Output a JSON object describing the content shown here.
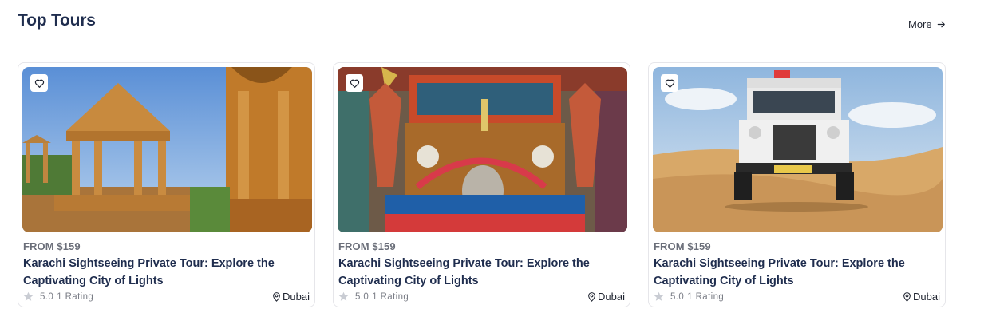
{
  "section": {
    "title": "Top Tours",
    "more_label": "More"
  },
  "cards": [
    {
      "image_label": "Sandstone cenotaph pavilions",
      "price": "FROM $159",
      "title": "Karachi Sightseeing Private Tour: Explore the Captivating City of Lights",
      "rating": "5.0",
      "rating_count": "1 Rating",
      "location": "Dubai"
    },
    {
      "image_label": "Decorated truck front",
      "price": "FROM $159",
      "title": "Karachi Sightseeing Private Tour: Explore the Captivating City of Lights",
      "rating": "5.0",
      "rating_count": "1 Rating",
      "location": "Dubai"
    },
    {
      "image_label": "White jeep in desert dunes",
      "price": "FROM $159",
      "title": "Karachi Sightseeing Private Tour: Explore the Captivating City of Lights",
      "rating": "5.0",
      "rating_count": "1 Rating",
      "location": "Dubai"
    }
  ],
  "icons": {
    "favorite": "heart-icon",
    "rating": "star-icon",
    "location": "map-pin-icon",
    "more": "arrow-right-icon"
  },
  "colors": {
    "heading": "#1f2d4e",
    "muted": "#6b6f7a",
    "star_inactive": "#c9ccd3",
    "border": "#e6e6ea"
  }
}
